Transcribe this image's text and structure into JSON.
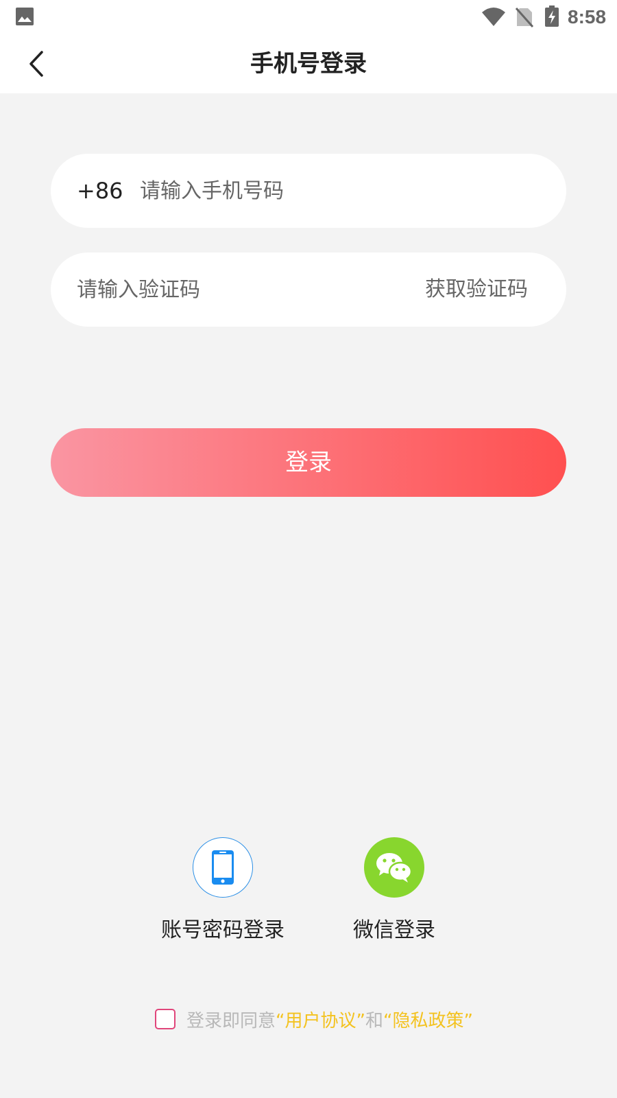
{
  "status_bar": {
    "time": "8:58",
    "icons": [
      "gallery-icon",
      "wifi-icon",
      "no-sim-icon",
      "battery-charging-icon"
    ]
  },
  "header": {
    "back_icon": "chevron-left-icon",
    "title": "手机号登录"
  },
  "form": {
    "country_code": "+86",
    "phone_placeholder": "请输入手机号码",
    "phone_value": "",
    "code_placeholder": "请输入验证码",
    "code_value": "",
    "get_code_label": "获取验证码"
  },
  "login_button": {
    "label": "登录",
    "gradient_start": "#fa95a2",
    "gradient_end": "#ff5050"
  },
  "alt_logins": [
    {
      "label": "账号密码登录",
      "icon": "phone-icon",
      "color": "#2b8fe6"
    },
    {
      "label": "微信登录",
      "icon": "wechat-icon",
      "color": "#88d62e"
    }
  ],
  "agreement": {
    "checked": false,
    "prefix": "登录即同意",
    "user_agreement": "“用户协议”",
    "connector": "和",
    "privacy_policy": "“隐私政策”",
    "link_color": "#f3c21f"
  }
}
